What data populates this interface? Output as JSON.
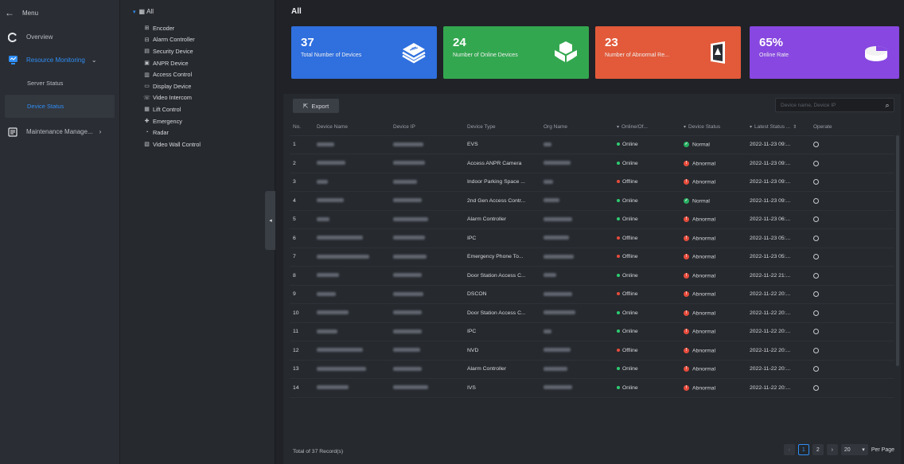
{
  "menu": {
    "header": "Menu",
    "items": [
      {
        "label": "Overview",
        "icon": "overview-icon"
      },
      {
        "label": "Resource Monitoring",
        "icon": "resource-monitoring-icon"
      },
      {
        "label": "Maintenance Manage...",
        "icon": "maintenance-icon"
      }
    ],
    "subitems": [
      "Server Status",
      "Device Status"
    ]
  },
  "tree": {
    "root": "All",
    "nodes": [
      {
        "label": "Encoder",
        "icon": "encoder-icon"
      },
      {
        "label": "Alarm Controller",
        "icon": "alarm-controller-icon"
      },
      {
        "label": "Security Device",
        "icon": "security-device-icon"
      },
      {
        "label": "ANPR Device",
        "icon": "anpr-device-icon"
      },
      {
        "label": "Access Control",
        "icon": "access-control-icon"
      },
      {
        "label": "Display Device",
        "icon": "display-device-icon"
      },
      {
        "label": "Video Intercom",
        "icon": "video-intercom-icon"
      },
      {
        "label": "Lift Control",
        "icon": "lift-control-icon"
      },
      {
        "label": "Emergency",
        "icon": "emergency-icon"
      },
      {
        "label": "Radar",
        "icon": "radar-icon"
      },
      {
        "label": "Video Wall Control",
        "icon": "video-wall-icon"
      }
    ]
  },
  "main": {
    "title": "All",
    "cards": [
      {
        "value": "37",
        "label": "Total Number of Devices",
        "color": "#2f6fde"
      },
      {
        "value": "24",
        "label": "Number of Online Devices",
        "color": "#33a74f"
      },
      {
        "value": "23",
        "label": "Number of Abnormal Re...",
        "color": "#e25a3a"
      },
      {
        "value": "65%",
        "label": "Online Rate",
        "color": "#8747e0"
      }
    ],
    "export_label": "Export",
    "search_placeholder": "Device name, Device IP",
    "columns": [
      "No.",
      "Device Name",
      "Device IP",
      "Device Type",
      "Org Name",
      "Online/Of...",
      "Device Status",
      "Latest Status ...",
      "Operate"
    ],
    "rows": [
      {
        "no": "1",
        "type": "EVS",
        "online": "Online",
        "status": "Normal",
        "latest": "2022-11-23 09:..."
      },
      {
        "no": "2",
        "type": "Access ANPR Camera",
        "online": "Online",
        "status": "Abnormal",
        "latest": "2022-11-23 09:..."
      },
      {
        "no": "3",
        "type": "Indoor Parking Space ...",
        "online": "Offline",
        "status": "Abnormal",
        "latest": "2022-11-23 09:..."
      },
      {
        "no": "4",
        "type": "2nd Gen Access Contr...",
        "online": "Online",
        "status": "Normal",
        "latest": "2022-11-23 09:..."
      },
      {
        "no": "5",
        "type": "Alarm Controller",
        "online": "Online",
        "status": "Abnormal",
        "latest": "2022-11-23 06:..."
      },
      {
        "no": "6",
        "type": "IPC",
        "online": "Offline",
        "status": "Abnormal",
        "latest": "2022-11-23 05:..."
      },
      {
        "no": "7",
        "type": "Emergency Phone To...",
        "online": "Offline",
        "status": "Abnormal",
        "latest": "2022-11-23 05:..."
      },
      {
        "no": "8",
        "type": "Door Station Access C...",
        "online": "Online",
        "status": "Abnormal",
        "latest": "2022-11-22 21:..."
      },
      {
        "no": "9",
        "type": "DSCON",
        "online": "Offline",
        "status": "Abnormal",
        "latest": "2022-11-22 20:..."
      },
      {
        "no": "10",
        "type": "Door Station Access C...",
        "online": "Online",
        "status": "Abnormal",
        "latest": "2022-11-22 20:..."
      },
      {
        "no": "11",
        "type": "IPC",
        "online": "Online",
        "status": "Abnormal",
        "latest": "2022-11-22 20:..."
      },
      {
        "no": "12",
        "type": "NVD",
        "online": "Offline",
        "status": "Abnormal",
        "latest": "2022-11-22 20:..."
      },
      {
        "no": "13",
        "type": "Alarm Controller",
        "online": "Online",
        "status": "Abnormal",
        "latest": "2022-11-22 20:..."
      },
      {
        "no": "14",
        "type": "IVS",
        "online": "Online",
        "status": "Abnormal",
        "latest": "2022-11-22 20:..."
      }
    ],
    "footer": "Total of 37 Record(s)",
    "pager": {
      "pages": [
        "1",
        "2"
      ],
      "page_size": "20",
      "per_page_label": "Per Page"
    }
  },
  "colors": {
    "online": "#2ecc71",
    "offline": "#e74c3c",
    "normal": "#27ae60",
    "abnormal": "#e74c3c",
    "accent": "#2f8ef5"
  }
}
